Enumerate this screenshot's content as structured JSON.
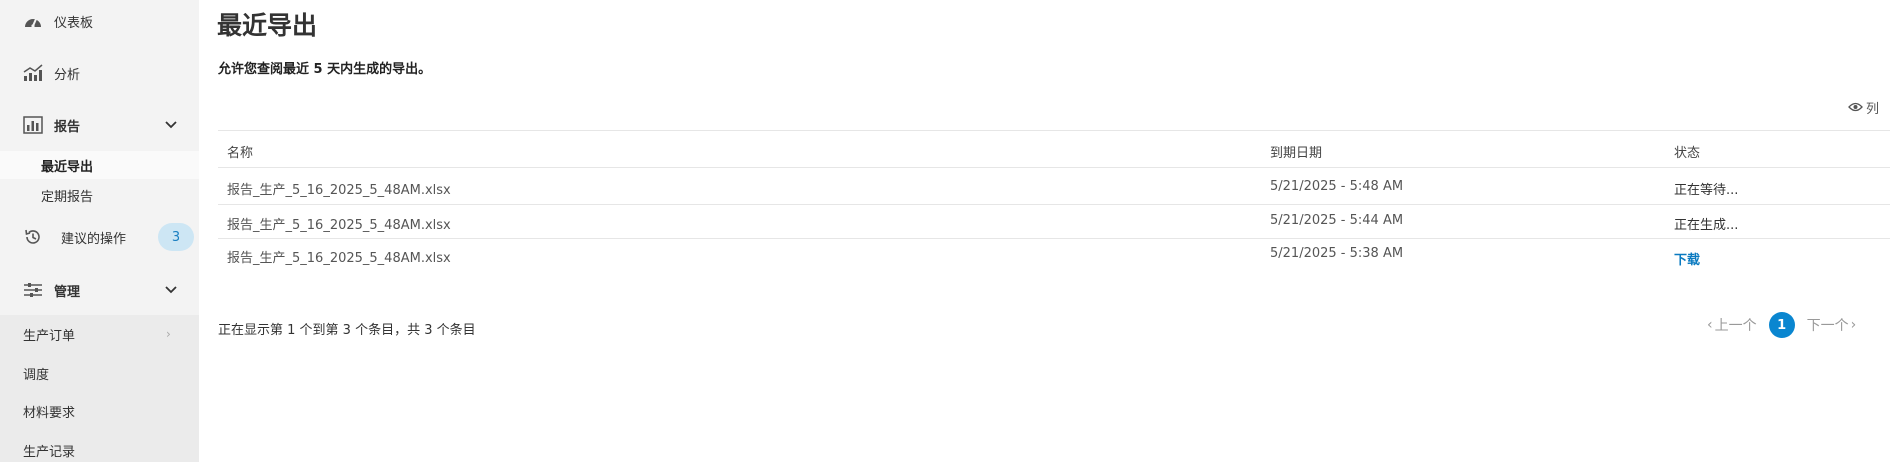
{
  "sidebar": {
    "items": [
      {
        "label": "仪表板",
        "icon": "gauge-icon"
      },
      {
        "label": "分析",
        "icon": "analytics-chart-icon"
      },
      {
        "label": "报告",
        "icon": "report-chart-icon"
      },
      {
        "label": "建议的操作",
        "icon": "history-icon",
        "badge": "3"
      },
      {
        "label": "管理",
        "icon": "sliders-icon"
      }
    ],
    "report_subitems": [
      {
        "label": "最近导出",
        "active": true
      },
      {
        "label": "定期报告",
        "active": false
      }
    ],
    "manage_subitems": [
      {
        "label": "生产订单"
      },
      {
        "label": "调度"
      },
      {
        "label": "材料要求"
      },
      {
        "label": "生产记录"
      }
    ]
  },
  "main": {
    "title": "最近导出",
    "description": "允许您查阅最近 5 天内生成的导出。",
    "columns_button": "列",
    "table": {
      "headers": [
        "名称",
        "到期日期",
        "状态"
      ],
      "rows": [
        {
          "name": "报告_生产_5_16_2025_5_48AM.xlsx",
          "expiry": "5/21/2025 - 5:48 AM",
          "status": "正在等待..."
        },
        {
          "name": "报告_生产_5_16_2025_5_48AM.xlsx",
          "expiry": "5/21/2025 - 5:44 AM",
          "status": "正在生成..."
        },
        {
          "name": "报告_生产_5_16_2025_5_48AM.xlsx",
          "expiry": "5/21/2025 - 5:38 AM",
          "status": "下载"
        }
      ]
    },
    "paging_info": "正在显示第 1 个到第 3 个条目，共 3 个条目",
    "pager": {
      "prev": "上一个",
      "current": "1",
      "next": "下一个"
    }
  },
  "colors": {
    "accent": "#0a86d0",
    "link": "#0a7ac0",
    "badge_bg": "#cde6f4",
    "sidebar_bg": "#f3f3f3"
  }
}
